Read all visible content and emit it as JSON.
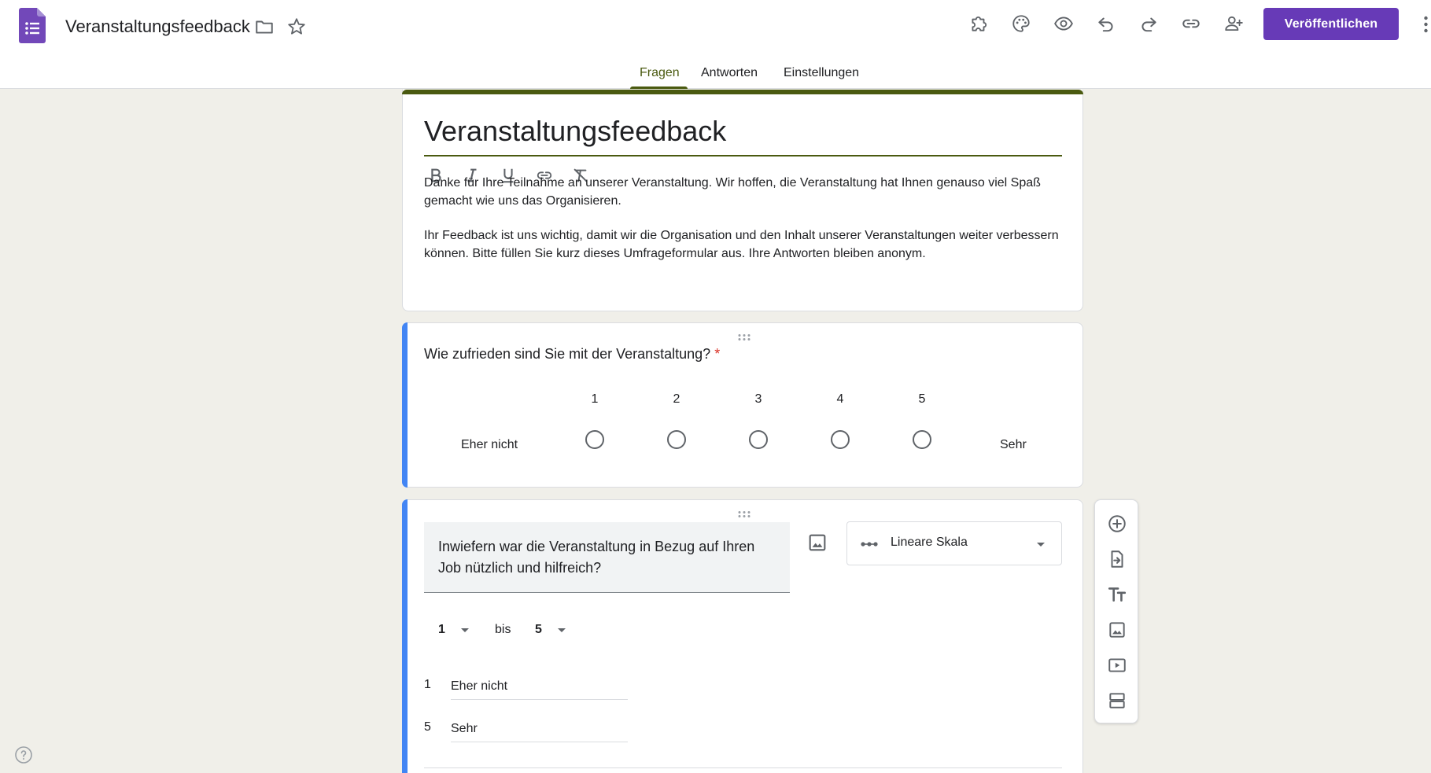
{
  "app": {
    "doc_title": "Veranstaltungsfeedback",
    "publish_label": "Veröffentlichen",
    "accent_color": "#673ab7",
    "theme_color": "#4a5a10",
    "question_accent_color": "#4285f4"
  },
  "header_icons": [
    "folder-icon",
    "star-icon",
    "addon-puzzle-icon",
    "palette-icon",
    "preview-eye-icon",
    "undo-icon",
    "redo-icon",
    "link-icon",
    "add-collaborator-icon",
    "more-vert-icon"
  ],
  "tabs": [
    {
      "label": "Fragen",
      "active": true
    },
    {
      "label": "Antworten",
      "active": false
    },
    {
      "label": "Einstellungen",
      "active": false
    }
  ],
  "form": {
    "title": "Veranstaltungsfeedback",
    "format_tools": [
      "bold-icon",
      "italic-icon",
      "underline-icon",
      "link-icon",
      "clear-format-icon"
    ],
    "description_p1": "Danke für Ihre Teilnahme an unserer Veranstaltung. Wir hoffen, die Veranstaltung hat Ihnen genauso viel Spaß gemacht wie uns das Organisieren.",
    "description_p2": "Ihr Feedback ist uns wichtig, damit wir die Organisation und den Inhalt unserer Veranstaltungen weiter verbessern können. Bitte füllen Sie kurz dieses Umfrageformular aus. Ihre Antworten bleiben anonym."
  },
  "question1": {
    "text": "Wie zufrieden sind Sie mit der Veranstaltung?",
    "required_mark": "*",
    "scale": [
      "1",
      "2",
      "3",
      "4",
      "5"
    ],
    "low_label": "Eher nicht",
    "high_label": "Sehr"
  },
  "question2": {
    "text": "Inwiefern war die Veranstaltung in Bezug auf Ihren Job nützlich und hilfreich?",
    "type_label": "Lineare Skala",
    "range_from": "1",
    "range_sep": "bis",
    "range_to": "5",
    "low_num": "1",
    "low_label": "Eher nicht",
    "high_num": "5",
    "high_label": "Sehr"
  },
  "side_toolbar": [
    "add-question-icon",
    "import-questions-icon",
    "add-title-icon",
    "add-image-icon",
    "add-video-icon",
    "add-section-icon"
  ]
}
